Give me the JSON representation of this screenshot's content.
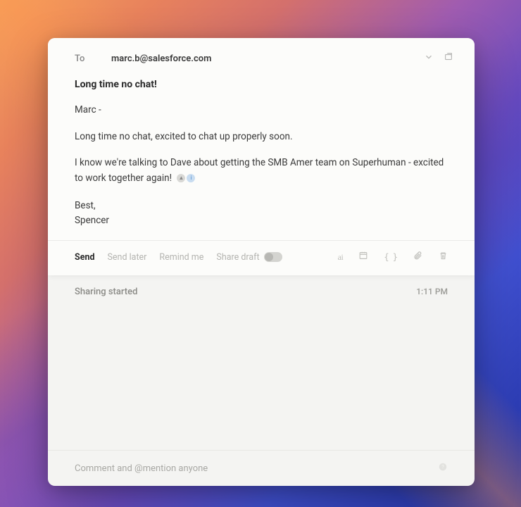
{
  "compose": {
    "to_label": "To",
    "to_value": "marc.b@salesforce.com",
    "subject": "Long time no chat!",
    "body": {
      "greeting": "Marc -",
      "p1": "Long time no chat, excited to chat up properly soon.",
      "p2": "I know we're talking to Dave about getting the SMB Amer team on Superhuman - excited to work together again!"
    },
    "signature": {
      "closing": "Best,",
      "name": "Spencer"
    }
  },
  "actions": {
    "send": "Send",
    "send_later": "Send later",
    "remind_me": "Remind me",
    "share_draft": "Share draft",
    "ai": "ai"
  },
  "activity": {
    "label": "Sharing started",
    "time": "1:11 PM"
  },
  "comment": {
    "placeholder": "Comment and @mention anyone"
  }
}
